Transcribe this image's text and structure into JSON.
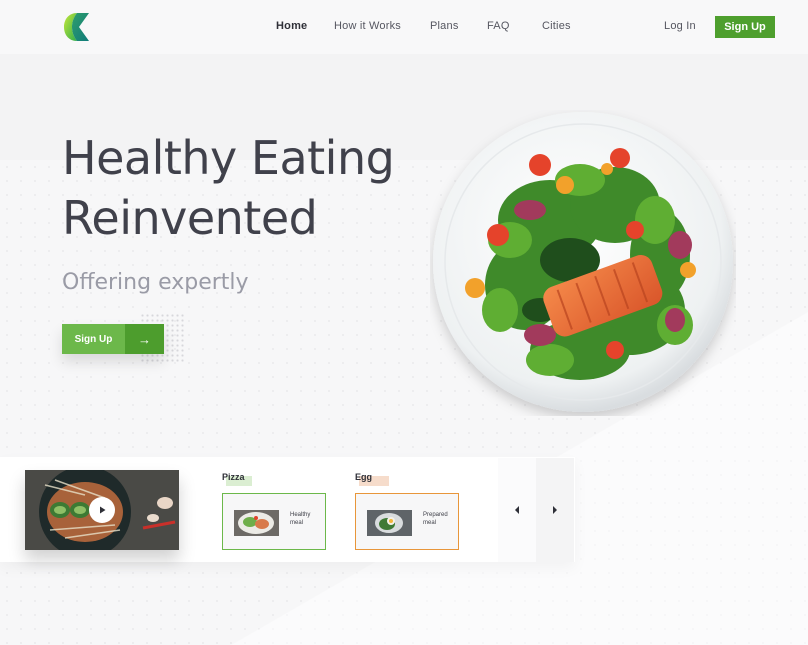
{
  "nav": {
    "links": [
      "Home",
      "How it Works",
      "Plans",
      "FAQ",
      "Cities"
    ],
    "login": "Log In",
    "signup": "Sign Up"
  },
  "hero": {
    "title_line1": "Healthy Eating",
    "title_line2": "Reinvented",
    "subtitle": "Offering expertly",
    "cta_label": "Sign Up",
    "cta_arrow": "→"
  },
  "categories": [
    {
      "label": "Pizza",
      "card_text": "Healthy meal",
      "accent": "#6cb84a",
      "highlight": "#dbeed2"
    },
    {
      "label": "Egg",
      "card_text": "Prepared meal",
      "accent": "#e8963a",
      "highlight": "#f6dccb"
    }
  ],
  "colors": {
    "brand_green": "#4e9f2e",
    "cta_green": "#6cb84a",
    "heading": "#40414b",
    "subtitle": "#9a9ba6"
  },
  "icons": {
    "play": "play-icon",
    "prev": "caret-left-icon",
    "next": "caret-right-icon",
    "arrow": "arrow-right-icon"
  }
}
